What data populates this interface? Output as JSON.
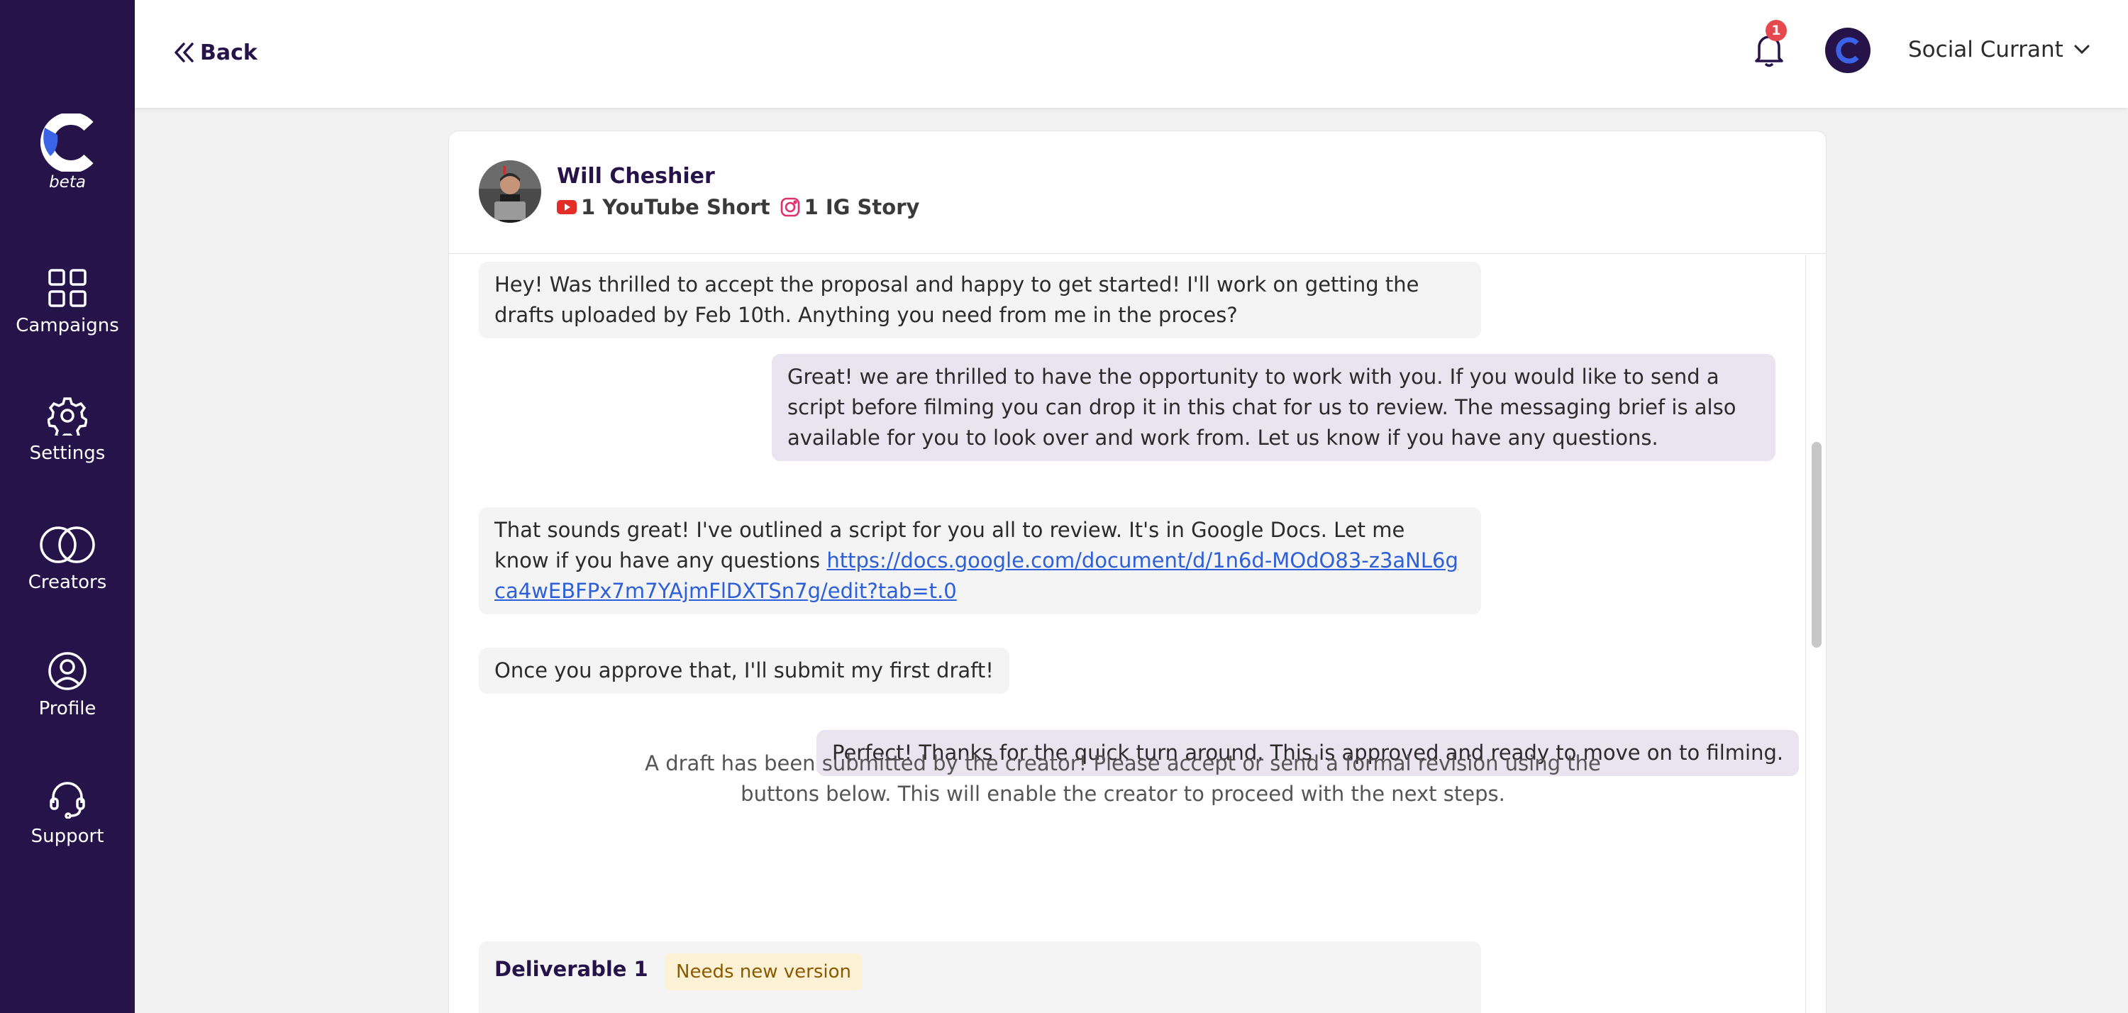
{
  "sidebar": {
    "beta_label": "beta",
    "items": [
      {
        "label": "Campaigns",
        "icon": "grid-icon"
      },
      {
        "label": "Settings",
        "icon": "gear-icon"
      },
      {
        "label": "Creators",
        "icon": "rings-icon"
      },
      {
        "label": "Profile",
        "icon": "user-circle-icon"
      },
      {
        "label": "Support",
        "icon": "headset-icon"
      }
    ]
  },
  "topbar": {
    "back_label": "Back",
    "notification_count": "1",
    "account_name": "Social Currant"
  },
  "chat": {
    "creator_name": "Will Cheshier",
    "deliverables": [
      {
        "label": "1 YouTube Short",
        "icon": "youtube-icon"
      },
      {
        "label": "1 IG Story",
        "icon": "instagram-icon"
      }
    ],
    "messages": [
      {
        "direction": "in",
        "text": "Hey! Was thrilled to accept the proposal and happy to get started! I'll work on getting the drafts uploaded by Feb 10th. Anything you need from me in the proces?"
      },
      {
        "direction": "out",
        "text": "Great! we are thrilled to have the opportunity to work with you. If you would like to send a script before filming you can drop it in this chat for us to review. The messaging brief is also available for you to look over and work from. Let us know if you have any questions."
      },
      {
        "direction": "in",
        "text": "That sounds great! I've outlined a script for you all to review. It's in Google Docs. Let me know if you have any questions",
        "link": "https://docs.google.com/document/d/1n6d-MOdO83-z3aNL6gca4wEBFPx7m7YAjmFlDXTSn7g/edit?tab=t.0"
      },
      {
        "direction": "in",
        "text": "Once you approve that, I'll submit my first draft!"
      },
      {
        "direction": "out",
        "text": "Perfect! Thanks for the quick turn around. This is approved and ready to move on to filming."
      }
    ],
    "system_note_line1": "A draft has been submitted by the creator! Please accept or send a formal revision using the",
    "system_note_line2": "buttons below. This will enable the creator to proceed with the next steps.",
    "deliverable_card": {
      "title": "Deliverable 1",
      "status": "Needs new version"
    }
  },
  "colors": {
    "sidebar_bg": "#261349",
    "accent_blue": "#2c5fd8",
    "outgoing_bubble": "#e9e4f0",
    "incoming_bubble": "#f3f4f3",
    "badge_red": "#e5484d",
    "status_badge_bg": "#fdf2d6"
  }
}
